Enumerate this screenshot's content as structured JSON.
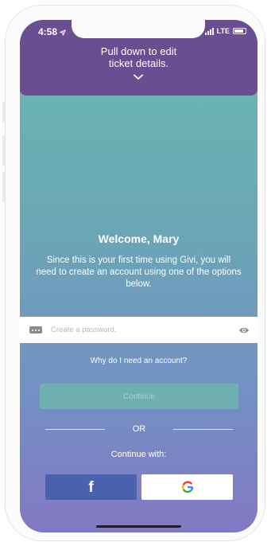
{
  "status_bar": {
    "time": "4:58",
    "network": "LTE"
  },
  "header": {
    "pull_line1": "Pull down to edit",
    "pull_line2": "ticket details."
  },
  "welcome": {
    "title": "Welcome, Mary",
    "body": "Since this is your first time using Givi, you will need to create an account using one of the options below."
  },
  "password": {
    "placeholder": "Create a password.",
    "value": ""
  },
  "why_link": "Why do I need an account?",
  "continue_button": "Continue",
  "or_label": "OR",
  "continue_with": "Continue with:",
  "social": {
    "facebook_glyph": "f",
    "facebook_color": "#4a62ad"
  },
  "colors": {
    "header_bg": "#6a4e91",
    "gradient_top": "#6ab9b3",
    "gradient_bottom": "#8378c4",
    "continue_disabled": "#6fb0ae"
  },
  "icons": [
    "location-arrow-icon",
    "signal-icon",
    "battery-icon",
    "chevron-down-icon",
    "password-dots-icon",
    "eye-icon",
    "facebook-icon",
    "google-icon"
  ]
}
